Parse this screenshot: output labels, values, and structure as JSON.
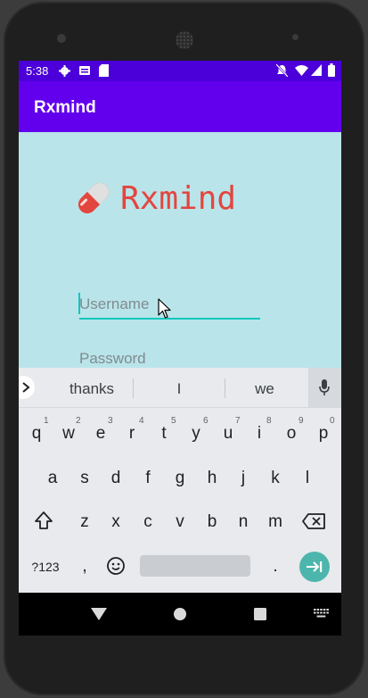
{
  "status_bar": {
    "time": "5:38"
  },
  "app_bar": {
    "title": "Rxmind"
  },
  "logo": {
    "text": "Rxmind",
    "icon": "pill-icon"
  },
  "login": {
    "username_placeholder": "Username",
    "password_placeholder": "Password"
  },
  "keyboard": {
    "suggestions": [
      "thanks",
      "I",
      "we"
    ],
    "row1": [
      "q",
      "w",
      "e",
      "r",
      "t",
      "y",
      "u",
      "i",
      "o",
      "p"
    ],
    "row1_hints": [
      "1",
      "2",
      "3",
      "4",
      "5",
      "6",
      "7",
      "8",
      "9",
      "0"
    ],
    "row2": [
      "a",
      "s",
      "d",
      "f",
      "g",
      "h",
      "j",
      "k",
      "l"
    ],
    "row3": [
      "z",
      "x",
      "c",
      "v",
      "b",
      "n",
      "m"
    ],
    "symbols_key": "?123",
    "comma_key": ",",
    "period_key": "."
  },
  "colors": {
    "status_bar": "#4b00d9",
    "app_bar": "#6200ee",
    "background": "#b9e4ea",
    "accent": "#11c6bd",
    "logo": "#e3463e",
    "enter_key": "#4db6ac"
  }
}
